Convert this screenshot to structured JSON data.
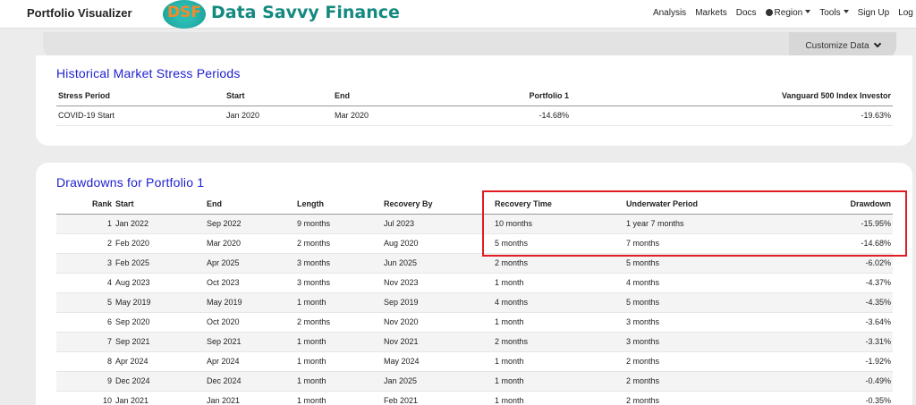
{
  "nav": {
    "title": "Portfolio Visualizer",
    "logo_text": "DSF",
    "brand_name": "Data Savvy Finance",
    "links": [
      "Analysis",
      "Markets",
      "Docs",
      "Region",
      "Tools",
      "Sign Up",
      "Log In"
    ]
  },
  "toolbar": {
    "customize_label": "Customize Data"
  },
  "stress": {
    "title": "Historical Market Stress Periods",
    "headers": [
      "Stress Period",
      "Start",
      "End",
      "Portfolio 1",
      "Vanguard 500 Index Investor"
    ],
    "rows": [
      [
        "COVID-19 Start",
        "Jan 2020",
        "Mar 2020",
        "-14.68%",
        "-19.63%"
      ]
    ]
  },
  "drawdowns": {
    "title": "Drawdowns for Portfolio 1",
    "headers": [
      "Rank",
      "Start",
      "End",
      "Length",
      "Recovery By",
      "Recovery Time",
      "Underwater Period",
      "Drawdown"
    ],
    "rows": [
      [
        "1",
        "Jan 2022",
        "Sep 2022",
        "9 months",
        "Jul 2023",
        "10 months",
        "1 year 7 months",
        "-15.95%"
      ],
      [
        "2",
        "Feb 2020",
        "Mar 2020",
        "2 months",
        "Aug 2020",
        "5 months",
        "7 months",
        "-14.68%"
      ],
      [
        "3",
        "Feb 2025",
        "Apr 2025",
        "3 months",
        "Jun 2025",
        "2 months",
        "5 months",
        "-6.02%"
      ],
      [
        "4",
        "Aug 2023",
        "Oct 2023",
        "3 months",
        "Nov 2023",
        "1 month",
        "4 months",
        "-4.37%"
      ],
      [
        "5",
        "May 2019",
        "May 2019",
        "1 month",
        "Sep 2019",
        "4 months",
        "5 months",
        "-4.35%"
      ],
      [
        "6",
        "Sep 2020",
        "Oct 2020",
        "2 months",
        "Nov 2020",
        "1 month",
        "3 months",
        "-3.64%"
      ],
      [
        "7",
        "Sep 2021",
        "Sep 2021",
        "1 month",
        "Nov 2021",
        "2 months",
        "3 months",
        "-3.31%"
      ],
      [
        "8",
        "Apr 2024",
        "Apr 2024",
        "1 month",
        "May 2024",
        "1 month",
        "2 months",
        "-1.92%"
      ],
      [
        "9",
        "Dec 2024",
        "Dec 2024",
        "1 month",
        "Jan 2025",
        "1 month",
        "2 months",
        "-0.49%"
      ],
      [
        "10",
        "Jan 2021",
        "Jan 2021",
        "1 month",
        "Feb 2021",
        "1 month",
        "2 months",
        "-0.35%"
      ]
    ]
  },
  "colors": {
    "brand": "#14897f",
    "title_blue": "#1d1fcf",
    "highlight": "#e11b22"
  }
}
